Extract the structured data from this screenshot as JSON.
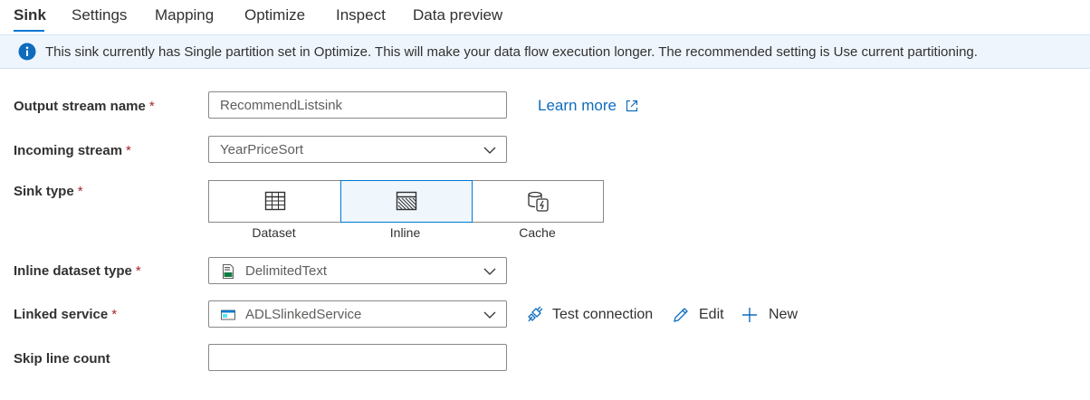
{
  "tabs": [
    "Sink",
    "Settings",
    "Mapping",
    "Optimize",
    "Inspect",
    "Data preview"
  ],
  "active_tab": "Sink",
  "info_bar": {
    "icon": "info-icon",
    "text": "This sink currently has Single partition set in Optimize. This will make your data flow execution longer. The recommended setting is Use current partitioning."
  },
  "form": {
    "output_stream": {
      "label": "Output stream name",
      "required": "*",
      "value": "RecommendListsink",
      "learn_more": "Learn more"
    },
    "incoming_stream": {
      "label": "Incoming stream",
      "required": "*",
      "value": "YearPriceSort"
    },
    "sink_type": {
      "label": "Sink type",
      "required": "*",
      "options": [
        {
          "label": "Dataset",
          "icon": "table-icon"
        },
        {
          "label": "Inline",
          "icon": "inline-dataset-icon"
        },
        {
          "label": "Cache",
          "icon": "cache-icon"
        }
      ],
      "selected": "Inline"
    },
    "inline_dataset_type": {
      "label": "Inline dataset type",
      "required": "*",
      "value": "DelimitedText",
      "icon": "csv-file-icon"
    },
    "linked_service": {
      "label": "Linked service",
      "required": "*",
      "value": "ADLSlinkedService",
      "icon": "storage-icon",
      "actions": {
        "test_connection": "Test connection",
        "edit": "Edit",
        "new": "New"
      }
    },
    "skip_line_count": {
      "label": "Skip line count",
      "value": ""
    }
  },
  "colors": {
    "accent": "#0078d4",
    "link": "#0f6cbd",
    "info_bg": "#eef5fd",
    "required": "#a4262c"
  }
}
